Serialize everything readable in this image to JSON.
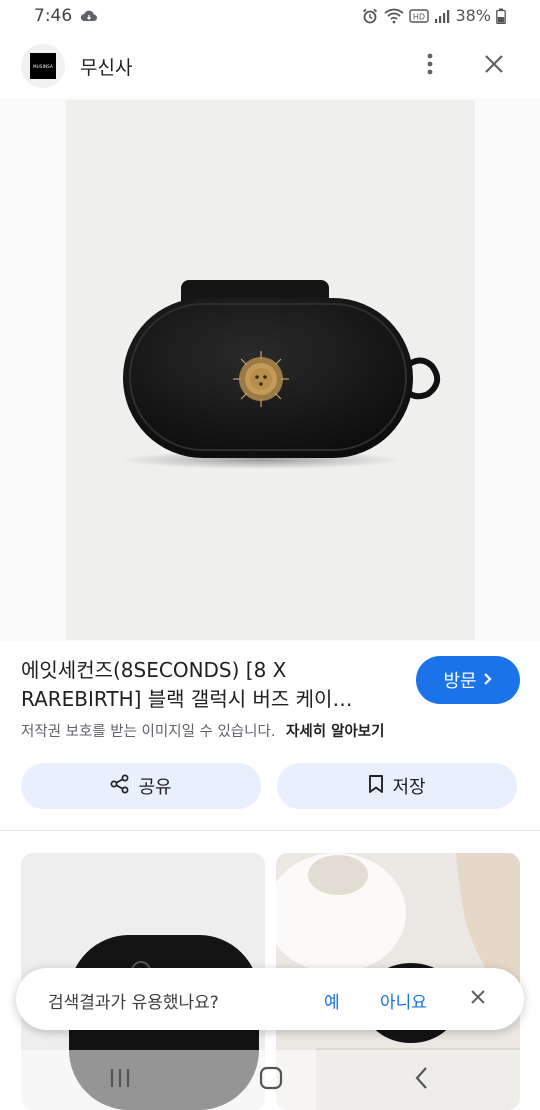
{
  "status_bar": {
    "time": "7:46",
    "battery": "38%"
  },
  "header": {
    "site_name": "무신사",
    "logo_text": "MUSINSA"
  },
  "product": {
    "image_alt": "black galaxy buds case with sun emblem",
    "title": "에잇세컨즈(8SECONDS) [8 X RAREBIRTH] 블랙 갤럭시 버즈 케이…",
    "visit_label": "방문",
    "copyright_text": "저작권 보호를 받는 이미지일 수 있습니다.",
    "learn_more": "자세히 알아보기"
  },
  "actions": {
    "share_label": "공유",
    "save_label": "저장"
  },
  "feedback": {
    "question": "검색결과가 유용했나요?",
    "yes": "예",
    "no": "아니요"
  },
  "colors": {
    "accent": "#1a73e8",
    "action_bg": "#e8f0fe"
  },
  "icons": [
    "cloud-icon",
    "alarm-icon",
    "wifi-icon",
    "hd-icon",
    "signal-icon",
    "battery-icon",
    "more-vert-icon",
    "close-icon",
    "chevron-right-icon",
    "share-icon",
    "bookmark-icon",
    "recents-icon",
    "home-icon",
    "back-icon"
  ]
}
